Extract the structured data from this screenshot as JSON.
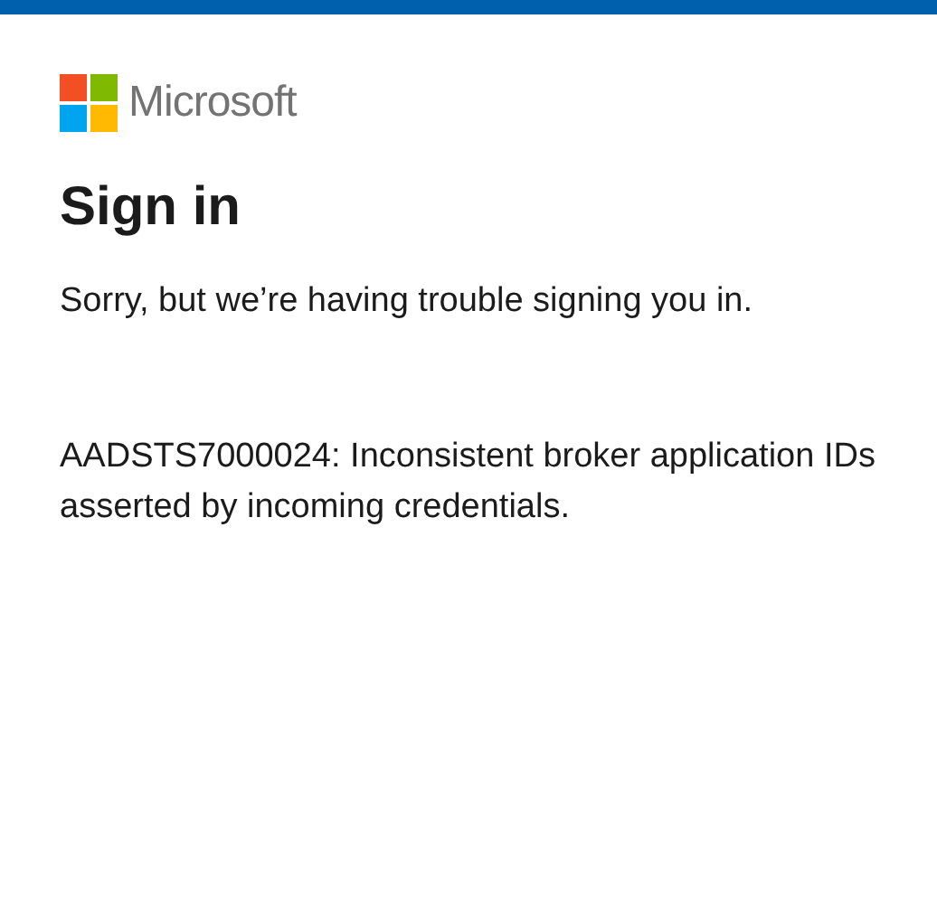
{
  "brand": {
    "name": "Microsoft"
  },
  "title": "Sign in",
  "message": "Sorry, but we’re having trouble signing you in.",
  "error": "AADSTS7000024: Inconsistent broker application IDs asserted by incoming credentials."
}
